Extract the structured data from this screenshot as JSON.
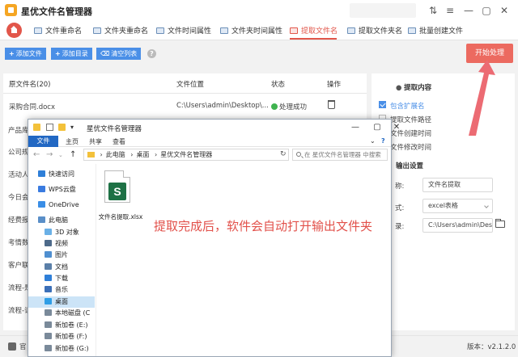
{
  "app": {
    "title": "星优文件名管理器",
    "window_controls": [
      "⇅",
      "≡",
      "—",
      "▢",
      "✕"
    ]
  },
  "nav": {
    "tabs": [
      {
        "label": "文件重命名",
        "active": false
      },
      {
        "label": "文件夹重命名",
        "active": false
      },
      {
        "label": "文件时间属性",
        "active": false
      },
      {
        "label": "文件夹时间属性",
        "active": false
      },
      {
        "label": "提取文件名",
        "active": true
      },
      {
        "label": "提取文件夹名",
        "active": false
      },
      {
        "label": "批量创建文件",
        "active": false
      }
    ]
  },
  "toolbar": {
    "add_file": "添加文件",
    "add_dir": "添加目录",
    "clear_list": "清空列表",
    "help": "?",
    "start": "开始处理"
  },
  "table": {
    "headers": [
      "原文件名(20)",
      "文件位置",
      "状态",
      "操作"
    ],
    "first_row": {
      "name": "采购合同.docx",
      "path": "C:\\Users\\admin\\Desktop\\...",
      "status": "处理成功"
    },
    "row_fragments": [
      "产品库",
      "公司规",
      "活动人",
      "今日会",
      "经费报",
      "考情数",
      "客户联",
      "流程-是",
      "流程-请"
    ]
  },
  "panel": {
    "extract_title": "提取内容",
    "options": [
      {
        "label": "包含扩展名",
        "checked": true
      },
      {
        "label": "提取文件路径",
        "checked": false
      },
      {
        "label": "文件创建时间",
        "checked": false
      },
      {
        "label": "文件修改时间",
        "checked": false
      }
    ],
    "output_title": "输出设置",
    "name_label": "称:",
    "name_value": "文件名提取",
    "format_label": "式:",
    "format_value": "excel表格",
    "dir_label": "录:",
    "dir_value": "C:\\Users\\admin\\Des"
  },
  "status": {
    "left": "官",
    "version": "版本：v2.1.2.0"
  },
  "explorer": {
    "title": "星优文件名管理器",
    "ribbon": {
      "file": "文件",
      "tabs": [
        "主页",
        "共享",
        "查看"
      ]
    },
    "address": {
      "parts": [
        "此电脑",
        "桌面",
        "星优文件名管理器"
      ]
    },
    "search_placeholder": "在 星优文件名管理器 中搜索",
    "sidebar": [
      {
        "label": "快速访问",
        "color": "#2f7fd8",
        "selected": false
      },
      {
        "label": "WPS云盘",
        "color": "#3a7be0",
        "selected": false
      },
      {
        "label": "OneDrive",
        "color": "#3a8ee6",
        "selected": false
      },
      {
        "label": "此电脑",
        "color": "#5a8fc8",
        "selected": false
      },
      {
        "label": "3D 对象",
        "color": "#6ab0e6",
        "selected": false
      },
      {
        "label": "视频",
        "color": "#4d6a8a",
        "selected": false
      },
      {
        "label": "图片",
        "color": "#4f8fd0",
        "selected": false
      },
      {
        "label": "文档",
        "color": "#5a7fa8",
        "selected": false
      },
      {
        "label": "下载",
        "color": "#2f7fd8",
        "selected": false
      },
      {
        "label": "音乐",
        "color": "#3b6fb8",
        "selected": false
      },
      {
        "label": "桌面",
        "color": "#2f9ee6",
        "selected": true
      },
      {
        "label": "本地磁盘 (C",
        "color": "#7a8a9a",
        "selected": false
      },
      {
        "label": "新加卷 (E:)",
        "color": "#7a8a9a",
        "selected": false
      },
      {
        "label": "新加卷 (F:)",
        "color": "#7a8a9a",
        "selected": false
      },
      {
        "label": "新加卷 (G:)",
        "color": "#7a8a9a",
        "selected": false
      }
    ],
    "file": {
      "name": "文件名提取.xlsx",
      "badge": "S"
    }
  },
  "annotation": {
    "text": "提取完成后，软件会自动打开输出文件夹",
    "color": "#e2504a"
  },
  "colors": {
    "accent": "#e2564a",
    "blue": "#4a8fe7",
    "excel": "#1e7145"
  }
}
